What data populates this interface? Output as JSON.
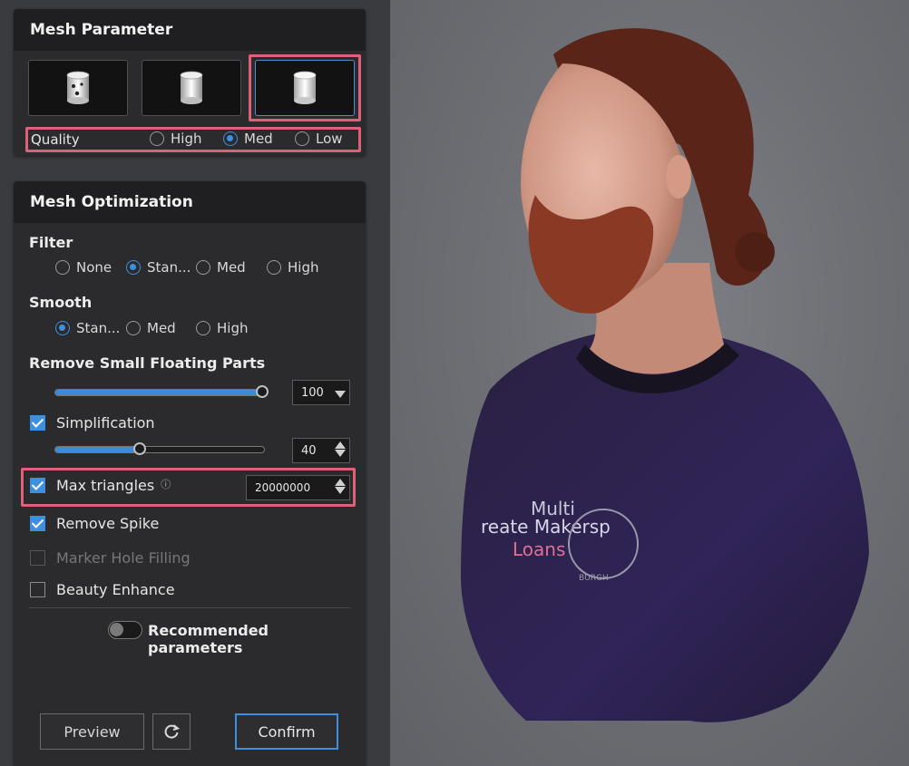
{
  "mesh_parameter": {
    "title": "Mesh Parameter",
    "presets": [
      {
        "icon": "cylinder-with-holes-icon"
      },
      {
        "icon": "cylinder-icon"
      },
      {
        "icon": "cylinder-smooth-icon",
        "selected": true
      }
    ],
    "quality": {
      "label": "Quality",
      "options": [
        "High",
        "Med",
        "Low"
      ],
      "selected": "Med"
    }
  },
  "mesh_optimization": {
    "title": "Mesh Optimization",
    "filter": {
      "label": "Filter",
      "options": [
        "None",
        "Stan...",
        "Med",
        "High"
      ],
      "selected": "Stan..."
    },
    "smooth": {
      "label": "Smooth",
      "options": [
        "Stan...",
        "Med",
        "High"
      ],
      "selected": "Stan..."
    },
    "remove_small_floating_parts": {
      "label": "Remove Small Floating Parts",
      "value": "100",
      "slider_fraction": 1.0
    },
    "simplification": {
      "label": "Simplification",
      "checked": true,
      "value": "40",
      "slider_fraction": 0.4
    },
    "max_triangles": {
      "label": "Max triangles",
      "checked": true,
      "value": "20000000",
      "info_icon": "info-icon"
    },
    "remove_spike": {
      "label": "Remove Spike",
      "checked": true
    },
    "marker_hole_filling": {
      "label": "Marker Hole Filling",
      "checked": false,
      "disabled": true
    },
    "beauty_enhance": {
      "label": "Beauty Enhance",
      "checked": false
    },
    "recommended": {
      "label": "Recommended parameters",
      "on": false
    }
  },
  "actions": {
    "preview": "Preview",
    "reset_icon": "refresh-icon",
    "confirm": "Confirm"
  },
  "viewport": {
    "shirt_text_lines": [
      "Multi",
      "reate Makersp",
      "Loans"
    ],
    "emblem_text": "BURGH"
  },
  "colors": {
    "accent": "#3d8fe0",
    "highlight": "#e0607a",
    "panel": "#2b2b2d",
    "header": "#1f1f21"
  }
}
